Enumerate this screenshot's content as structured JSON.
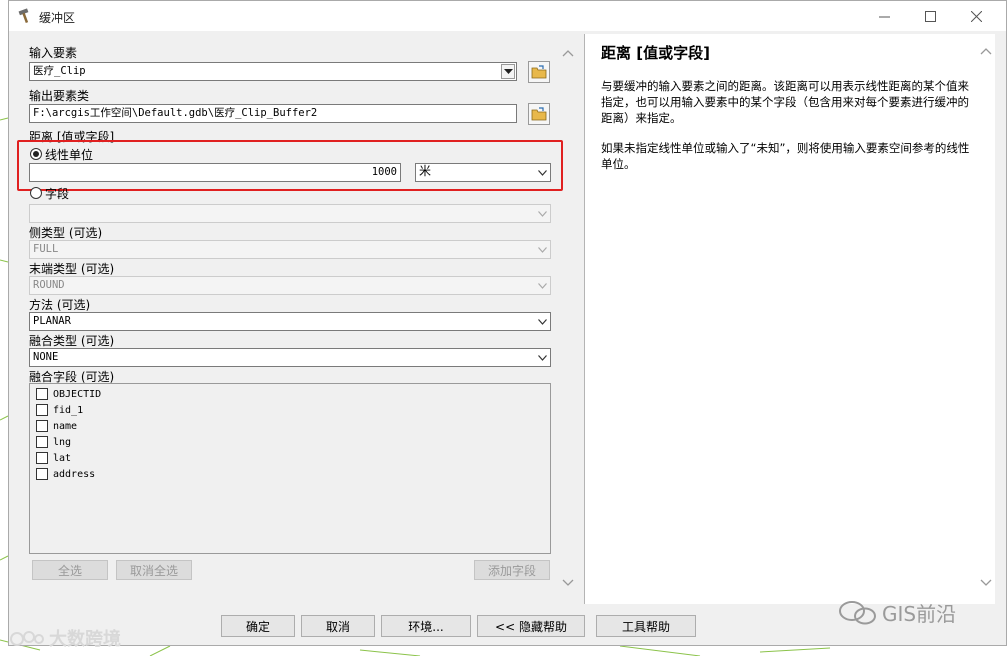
{
  "window": {
    "title": "缓冲区"
  },
  "form": {
    "input_features": {
      "label": "输入要素",
      "value": "医疗_Clip"
    },
    "output_features": {
      "label": "输出要素类",
      "value": "F:\\arcgis工作空间\\Default.gdb\\医疗_Clip_Buffer2"
    },
    "distance": {
      "label": "距离 [值或字段]",
      "linear_unit_label": "线性单位",
      "linear_value": "1000",
      "unit_value": "米",
      "field_label": "字段",
      "field_value": ""
    },
    "side_type": {
      "label": "侧类型 (可选)",
      "value": "FULL"
    },
    "end_type": {
      "label": "末端类型 (可选)",
      "value": "ROUND"
    },
    "method": {
      "label": "方法 (可选)",
      "value": "PLANAR"
    },
    "dissolve_type": {
      "label": "融合类型 (可选)",
      "value": "NONE"
    },
    "dissolve_fields": {
      "label": "融合字段 (可选)",
      "items": [
        "OBJECTID",
        "fid_1",
        "name",
        "lng",
        "lat",
        "address"
      ]
    },
    "select_all": "全选",
    "clear_all": "取消全选",
    "add_field": "添加字段"
  },
  "help": {
    "title": "距离 [值或字段]",
    "para1": "与要缓冲的输入要素之间的距离。该距离可以用表示线性距离的某个值来指定，也可以用输入要素中的某个字段（包含用来对每个要素进行缓冲的距离）来指定。",
    "para2": "如果未指定线性单位或输入了“未知”，则将使用输入要素空间参考的线性单位。"
  },
  "buttons": {
    "ok": "确定",
    "cancel": "取消",
    "environments": "环境...",
    "hide_help": "<< 隐藏帮助",
    "tool_help": "工具帮助"
  },
  "watermarks": {
    "left": "大数跨境",
    "right": "GIS前沿"
  },
  "colors": {
    "highlight": "#e02020",
    "window_bg": "#f0f0f0"
  }
}
